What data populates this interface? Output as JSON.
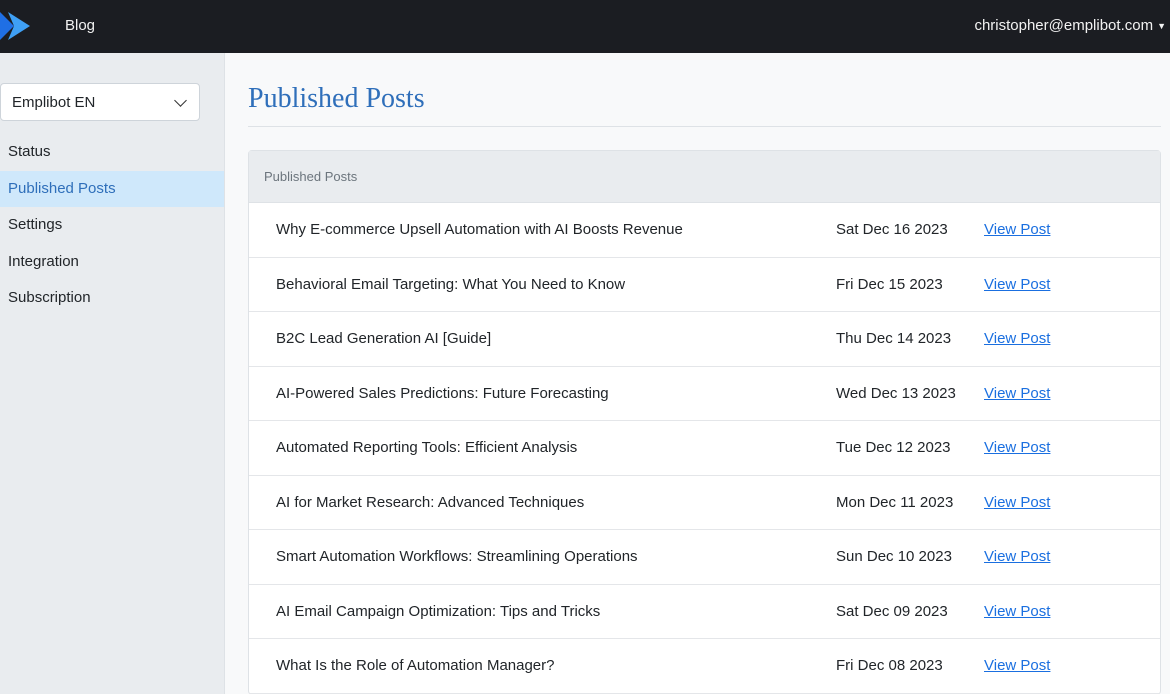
{
  "header": {
    "title": "Blog",
    "logo_icon": "play-chevron-logo",
    "user_email": "christopher@emplibot.com",
    "accent": "#2f6fba"
  },
  "sidebar": {
    "site_select": {
      "value": "Emplibot EN"
    },
    "items": [
      {
        "label": "Status",
        "active": false
      },
      {
        "label": "Published Posts",
        "active": true
      },
      {
        "label": "Settings",
        "active": false
      },
      {
        "label": "Integration",
        "active": false
      },
      {
        "label": "Subscription",
        "active": false
      }
    ]
  },
  "main": {
    "page_title": "Published Posts",
    "card_header": "Published Posts",
    "link_color": "#1a6fe0",
    "posts": [
      {
        "title": "Why E-commerce Upsell Automation with AI Boosts Revenue",
        "date": "Sat Dec 16 2023",
        "link": "View Post"
      },
      {
        "title": "Behavioral Email Targeting: What You Need to Know",
        "date": "Fri Dec 15 2023",
        "link": "View Post"
      },
      {
        "title": "B2C Lead Generation AI [Guide]",
        "date": "Thu Dec 14 2023",
        "link": "View Post"
      },
      {
        "title": "AI-Powered Sales Predictions: Future Forecasting",
        "date": "Wed Dec 13 2023",
        "link": "View Post"
      },
      {
        "title": "Automated Reporting Tools: Efficient Analysis",
        "date": "Tue Dec 12 2023",
        "link": "View Post"
      },
      {
        "title": "AI for Market Research: Advanced Techniques",
        "date": "Mon Dec 11 2023",
        "link": "View Post"
      },
      {
        "title": "Smart Automation Workflows: Streamlining Operations",
        "date": "Sun Dec 10 2023",
        "link": "View Post"
      },
      {
        "title": "AI Email Campaign Optimization: Tips and Tricks",
        "date": "Sat Dec 09 2023",
        "link": "View Post"
      },
      {
        "title": "What Is the Role of Automation Manager?",
        "date": "Fri Dec 08 2023",
        "link": "View Post"
      }
    ]
  }
}
